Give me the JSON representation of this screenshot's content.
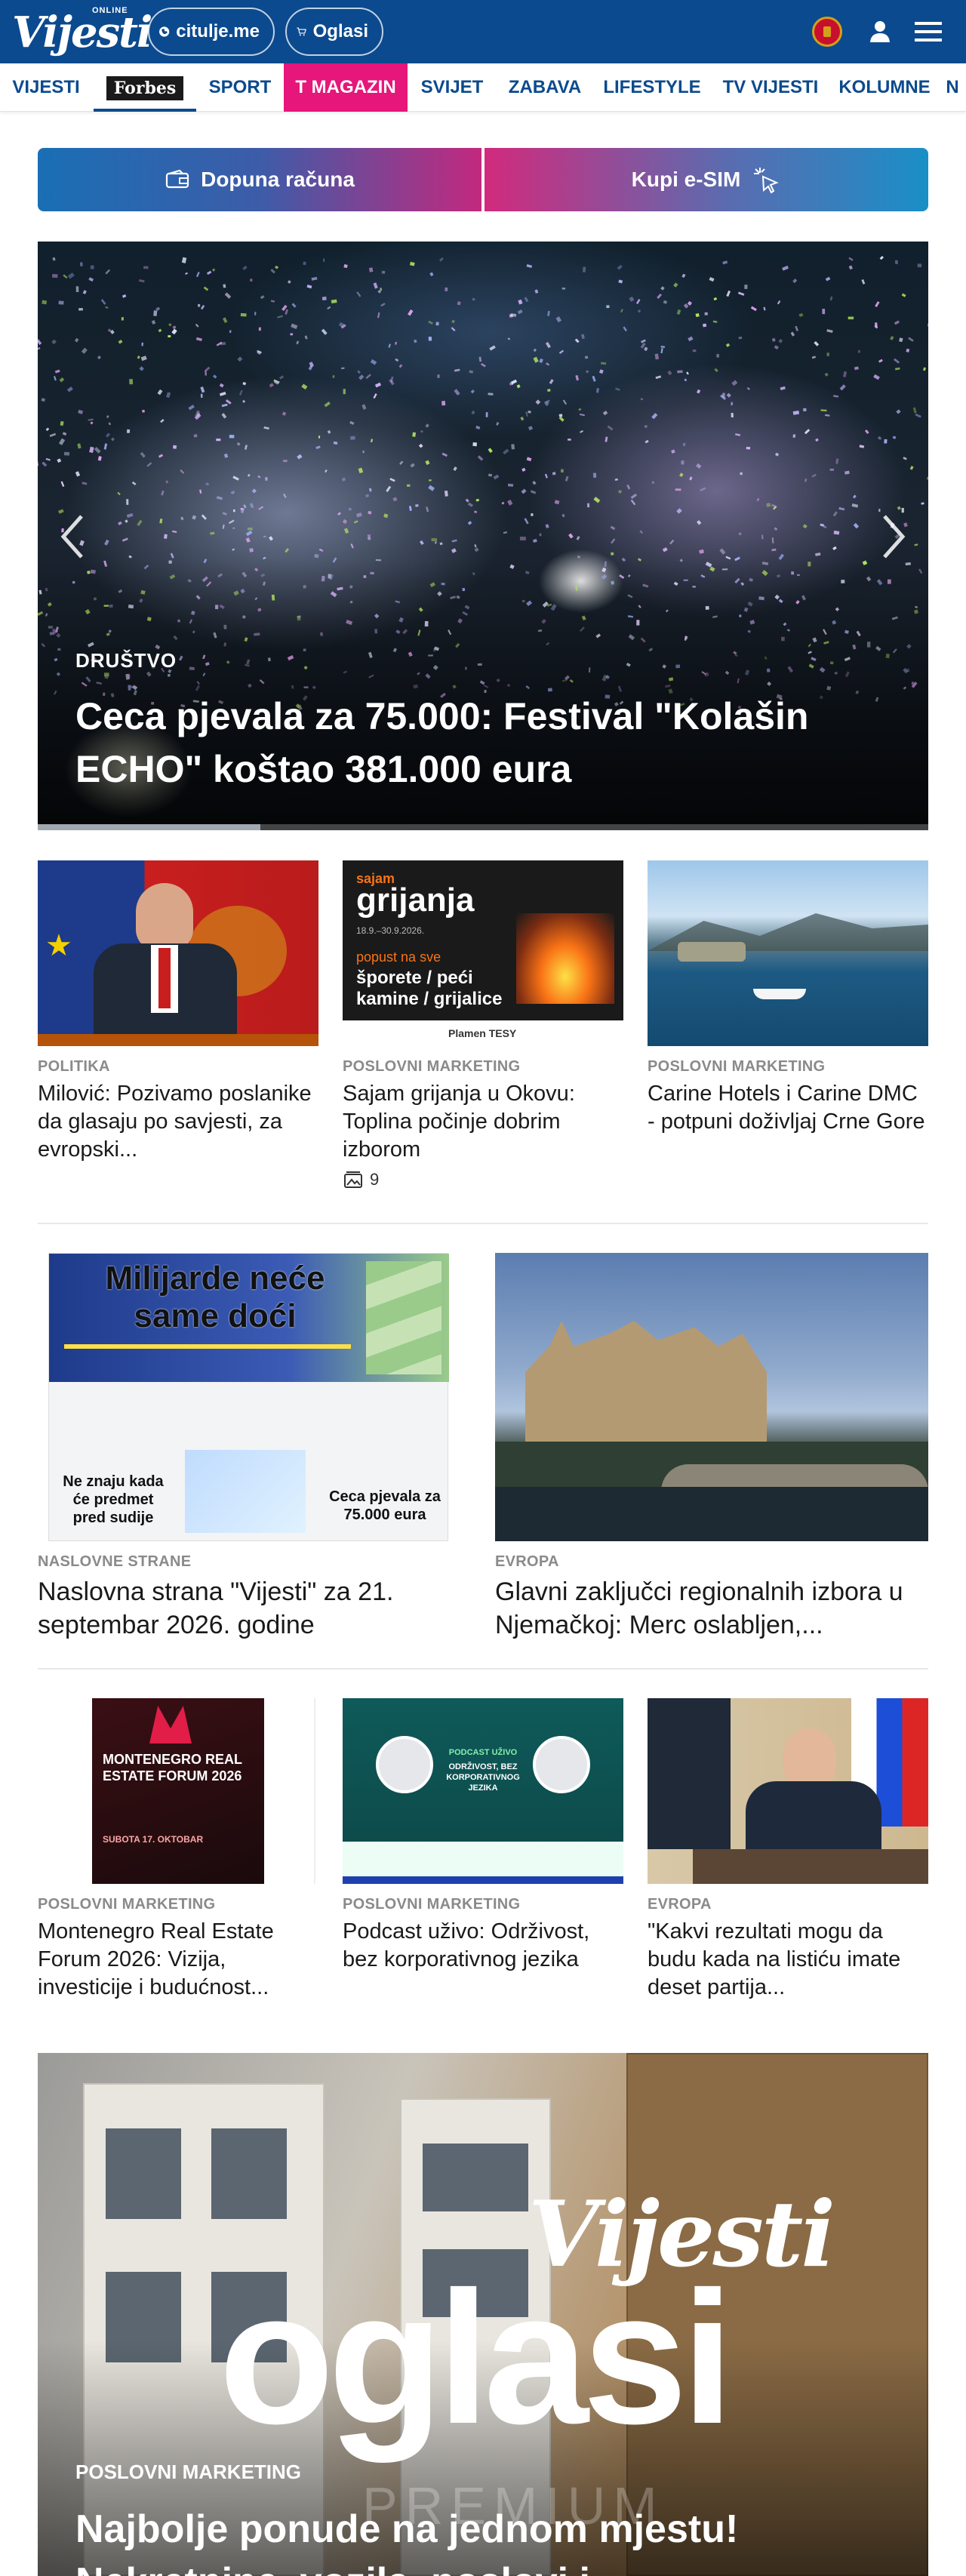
{
  "header": {
    "logo_online": "ONLINE",
    "logo_text": "Vijesti",
    "pill_citulje": "citulje.me",
    "pill_oglasi": "Oglasi"
  },
  "nav": {
    "items": [
      "VIJESTI",
      "Forbes",
      "SPORT",
      "T MAGAZIN",
      "SVIJET",
      "ZABAVA",
      "LIFESTYLE",
      "TV VIJESTI",
      "KOLUMNE",
      "N"
    ]
  },
  "actions": {
    "topup": "Dopuna računa",
    "esim": "Kupi e-SIM"
  },
  "hero": {
    "category": "DRUŠTVO",
    "title": "Ceca pjevala za 75.000: Festival \"Kolašin ECHO\" koštao 381.000 eura",
    "progress": 0.25
  },
  "row1": [
    {
      "category": "POLITIKA",
      "title": "Milović: Pozivamo poslanike da glasaju po savjesti, za evropski..."
    },
    {
      "category": "POSLOVNI MARKETING",
      "title": "Sajam grijanja u Okovu: Toplina počinje dobrim izborom",
      "gallery_count": "9",
      "ad": {
        "brand_small": "sajam",
        "brand_big": "grijanja",
        "dates": "18.9.–30.9.2026.",
        "promo": "popust na sve",
        "promo_items": "šporete / peći kamine / grijalice",
        "footer": "Plamen   TESY"
      }
    },
    {
      "category": "POSLOVNI MARKETING",
      "title": "Carine Hotels i Carine DMC - potpuni doživljaj Crne Gore"
    }
  ],
  "row2": [
    {
      "category": "NASLOVNE STRANE",
      "title": "Naslovna strana \"Vijesti\" za 21. septembar 2026. godine",
      "cover": {
        "headline": "Milijarde neće same doći",
        "side1": "Ne znaju kada će predmet pred sudije",
        "side2": "Ceca pjevala za 75.000 eura"
      }
    },
    {
      "category": "EVROPA",
      "title": "Glavni zaključci regionalnih izbora u Njemačkoj: Merc oslabljen,..."
    }
  ],
  "row3": [
    {
      "category": "POSLOVNI MARKETING",
      "title": "Montenegro Real Estate Forum 2026: Vizija, investicije i budućnost...",
      "poster": {
        "title": "MONTENEGRO REAL ESTATE FORUM 2026",
        "date": "SUBOTA 17. OKTOBAR"
      }
    },
    {
      "category": "POSLOVNI MARKETING",
      "title": "Podcast uživo: Održivost, bez korporativnog jezika",
      "poster": {
        "label": "PODCAST UŽIVO",
        "title": "ODRŽIVOST, BEZ KORPORATIVNOG JEZIKA"
      }
    },
    {
      "category": "EVROPA",
      "title": "\"Kakvi rezultati mogu da budu kada na listiću imate deset partija..."
    }
  ],
  "banner": {
    "brand_top": "Vijesti",
    "brand_big": "oglasi",
    "premium": "PREMIUM",
    "category": "POSLOVNI MARKETING",
    "title": "Najbolje ponude na jednom mjestu! Nekretnine, vozila, poslovi i..."
  },
  "colors": {
    "brand_blue": "#0b4a8e",
    "tmagazin_pink": "#e6167a"
  }
}
